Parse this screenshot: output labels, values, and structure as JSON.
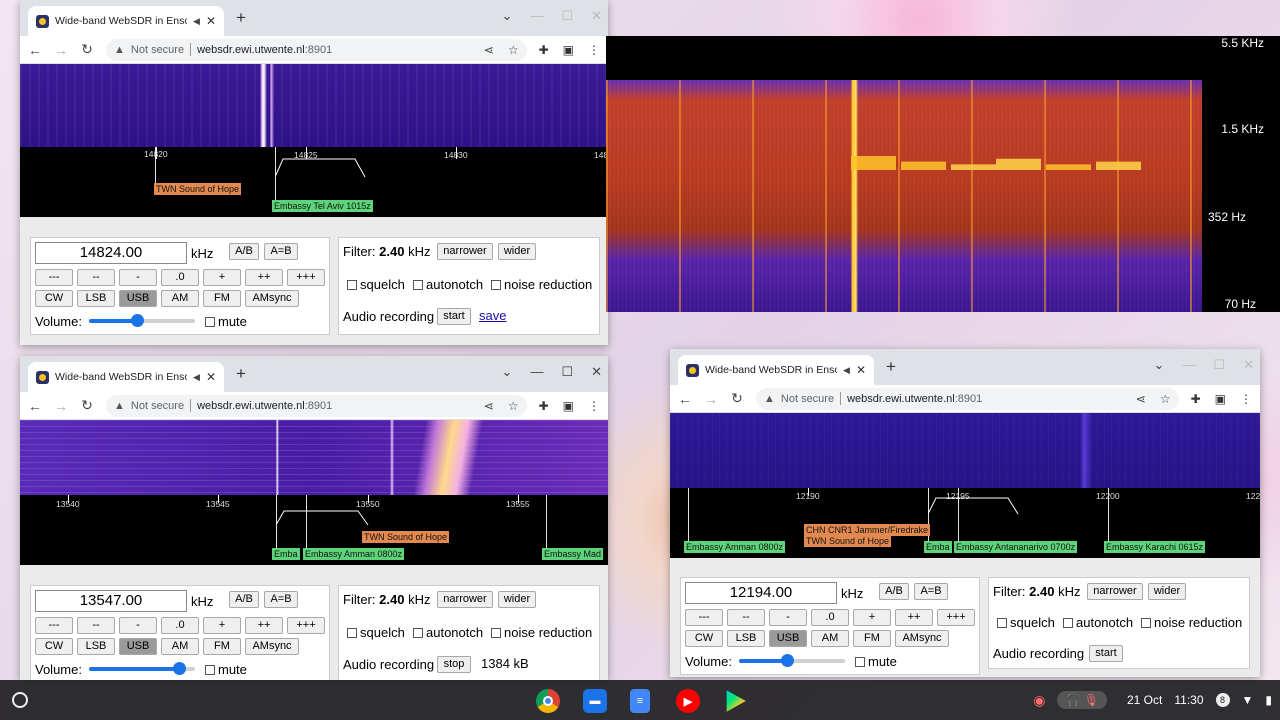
{
  "windows": [
    {
      "tab_title": "Wide-band WebSDR in Ensc",
      "url_warning": "Not secure",
      "url_host": "websdr.ewi.utwente.nl",
      "url_port": ":8901",
      "scale_ticks": [
        "14820",
        "14825",
        "14830",
        "148"
      ],
      "stations": [
        "TWN Sound of Hope",
        "Embassy Tel Aviv 1015z"
      ],
      "freq": "14824.00",
      "unit": "kHz",
      "ab": "A/B",
      "aeqb": "A=B",
      "steps": [
        "---",
        "--",
        "-",
        ".0",
        "+",
        "++",
        "+++"
      ],
      "modes": [
        "CW",
        "LSB",
        "USB",
        "AM",
        "FM",
        "AMsync"
      ],
      "volume_label": "Volume:",
      "volume_level": 0.45,
      "mute_label": "mute",
      "filter_label": "Filter:",
      "filter_value": "2.40",
      "filter_unit": "kHz",
      "narrower": "narrower",
      "wider": "wider",
      "squelch": "squelch",
      "autonotch": "autonotch",
      "noise_reduction": "noise reduction",
      "rec_label": "Audio recording",
      "rec_button": "start",
      "rec_extra": "save"
    },
    {
      "tab_title": "Wide-band WebSDR in Ensc",
      "url_warning": "Not secure",
      "url_host": "websdr.ewi.utwente.nl",
      "url_port": ":8901",
      "scale_ticks": [
        "13540",
        "13545",
        "13550",
        "13555"
      ],
      "stations": [
        "TWN Sound of Hope",
        "Emba",
        "Embassy Amman 0800z",
        "Embassy Mad"
      ],
      "freq": "13547.00",
      "unit": "kHz",
      "ab": "A/B",
      "aeqb": "A=B",
      "steps": [
        "---",
        "--",
        "-",
        ".0",
        "+",
        "++",
        "+++"
      ],
      "modes": [
        "CW",
        "LSB",
        "USB",
        "AM",
        "FM",
        "AMsync"
      ],
      "volume_label": "Volume:",
      "volume_level": 0.85,
      "mute_label": "mute",
      "filter_label": "Filter:",
      "filter_value": "2.40",
      "filter_unit": "kHz",
      "narrower": "narrower",
      "wider": "wider",
      "squelch": "squelch",
      "autonotch": "autonotch",
      "noise_reduction": "noise reduction",
      "rec_label": "Audio recording",
      "rec_button": "stop",
      "rec_extra": "1384 kB"
    },
    {
      "tab_title": "Wide-band WebSDR in Ensc",
      "url_warning": "Not secure",
      "url_host": "websdr.ewi.utwente.nl",
      "url_port": ":8901",
      "scale_ticks": [
        "12190",
        "12195",
        "12200",
        "122"
      ],
      "stations": [
        "Embassy Amman 0800z",
        "CHN CNR1 Jammer/Firedrake",
        "TWN Sound of Hope",
        "Emba",
        "Embassy Antananarivo 0700z",
        "Embassy Karachi 0615z"
      ],
      "freq": "12194.00",
      "unit": "kHz",
      "ab": "A/B",
      "aeqb": "A=B",
      "steps": [
        "---",
        "--",
        "-",
        ".0",
        "+",
        "++",
        "+++"
      ],
      "modes": [
        "CW",
        "LSB",
        "USB",
        "AM",
        "FM",
        "AMsync"
      ],
      "volume_label": "Volume:",
      "volume_level": 0.45,
      "mute_label": "mute",
      "filter_label": "Filter:",
      "filter_value": "2.40",
      "filter_unit": "kHz",
      "narrower": "narrower",
      "wider": "wider",
      "squelch": "squelch",
      "autonotch": "autonotch",
      "noise_reduction": "noise reduction",
      "rec_label": "Audio recording",
      "rec_button": "start",
      "rec_extra": ""
    }
  ],
  "spectrogram": {
    "labels": [
      "5.5 KHz",
      "1.5 KHz",
      "352 Hz",
      "70 Hz"
    ]
  },
  "shelf": {
    "apps": [
      "chrome-icon",
      "files-icon",
      "docs-icon",
      "youtube-icon",
      "play-store-icon"
    ],
    "date": "21 Oct",
    "time": "11:30",
    "badge": "8"
  },
  "colors": {
    "waterfall": "#3a1590",
    "label_orange": "#e3894f",
    "label_green": "#5ed47a",
    "usb_selected": "#9a9a9a"
  }
}
